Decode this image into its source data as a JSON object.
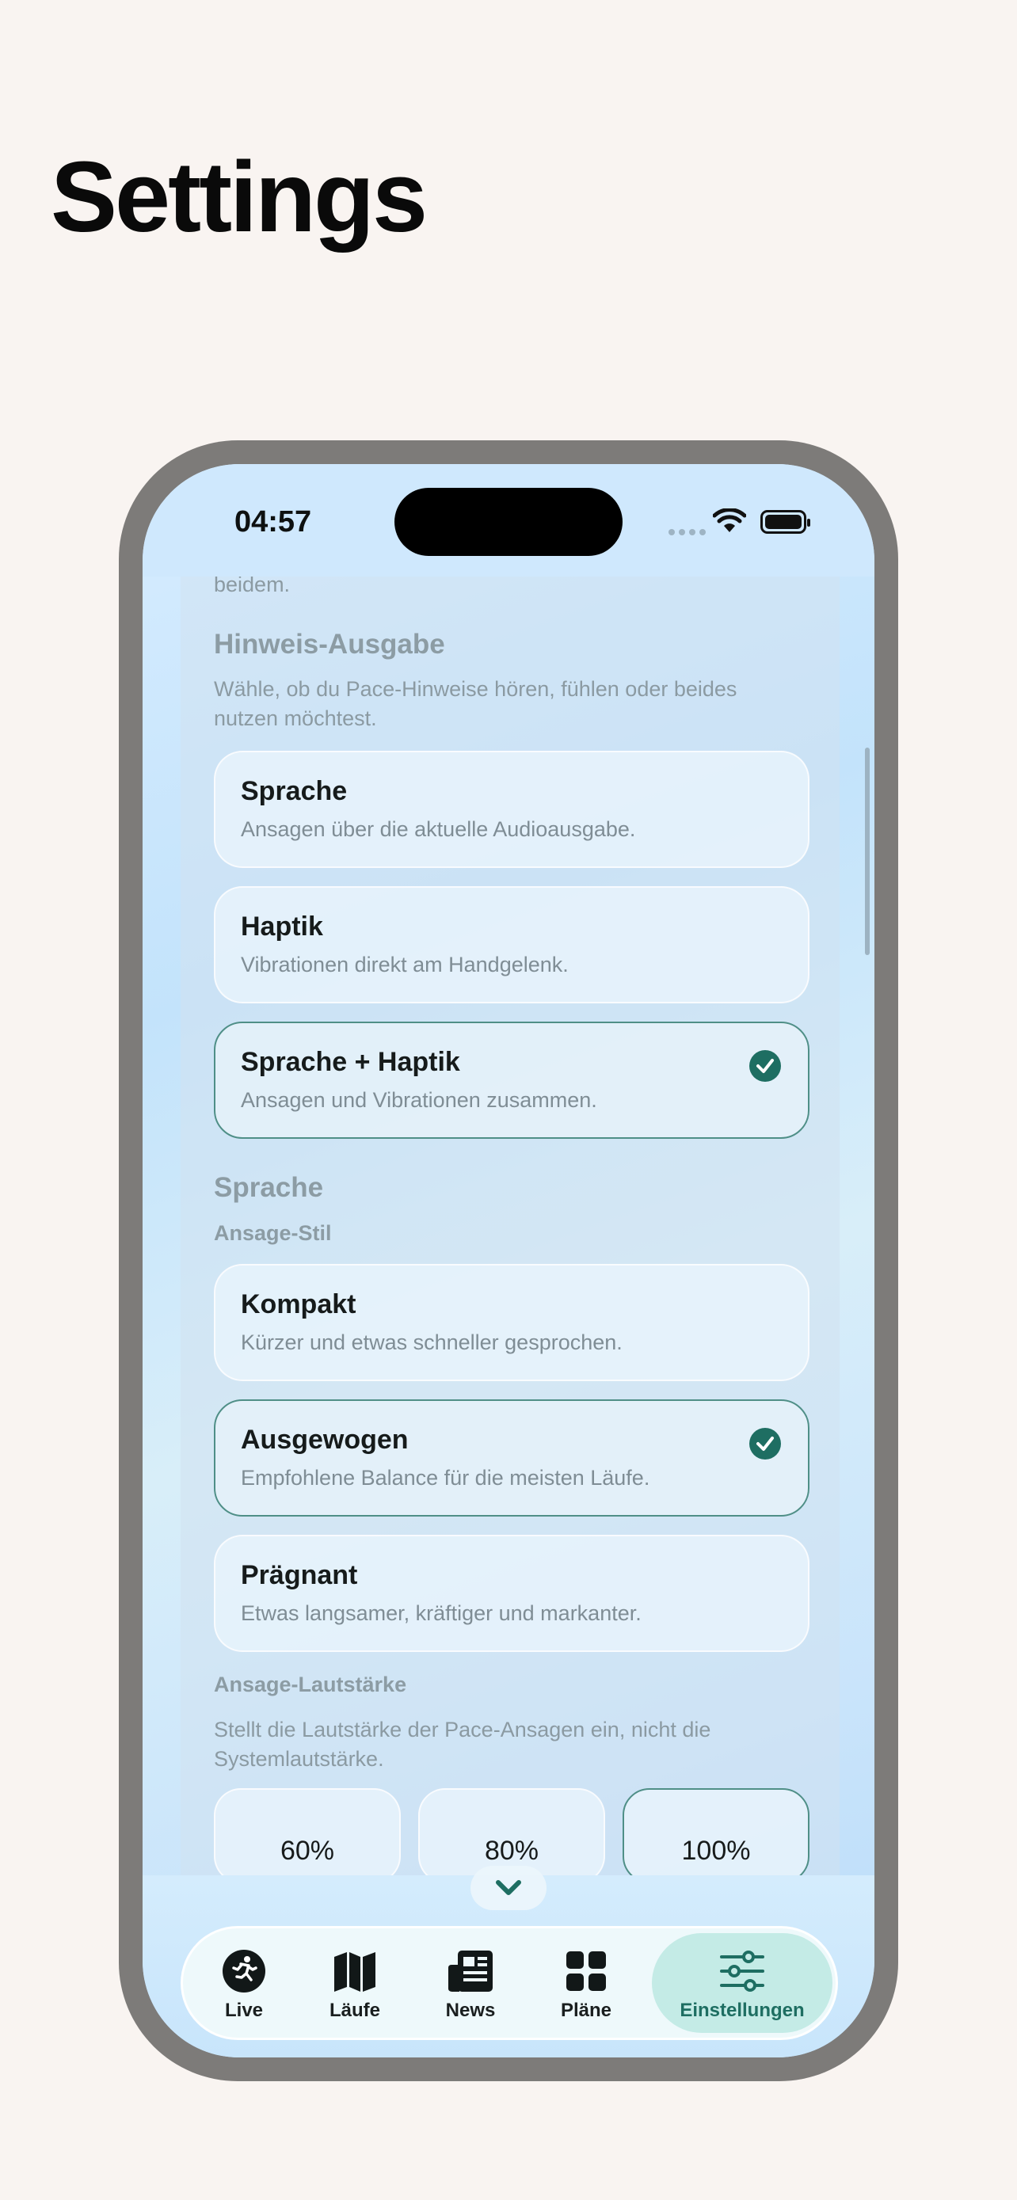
{
  "page": {
    "title": "Settings"
  },
  "status_bar": {
    "time": "04:57"
  },
  "content": {
    "top_clip_text": "beidem.",
    "hint_output": {
      "title": "Hinweis-Ausgabe",
      "description": "Wähle, ob du Pace-Hinweise hören, fühlen oder beides nutzen möchtest.",
      "options": [
        {
          "title": "Sprache",
          "description": "Ansagen über die aktuelle Audioausgabe.",
          "selected": false
        },
        {
          "title": "Haptik",
          "description": "Vibrationen direkt am Handgelenk.",
          "selected": false
        },
        {
          "title": "Sprache + Haptik",
          "description": "Ansagen und Vibrationen zusammen.",
          "selected": true
        }
      ]
    },
    "language": {
      "title": "Sprache",
      "style_label": "Ansage-Stil",
      "style_options": [
        {
          "title": "Kompakt",
          "description": "Kürzer und etwas schneller gesprochen.",
          "selected": false
        },
        {
          "title": "Ausgewogen",
          "description": "Empfohlene Balance für die meisten Läufe.",
          "selected": true
        },
        {
          "title": "Prägnant",
          "description": "Etwas langsamer, kräftiger und markanter.",
          "selected": false
        }
      ],
      "volume_label": "Ansage-Lautstärke",
      "volume_description": "Stellt die Lautstärke der Pace-Ansagen ein, nicht die Systemlautstärke.",
      "volume_options": [
        {
          "label": "60%",
          "selected": false
        },
        {
          "label": "80%",
          "selected": false
        },
        {
          "label": "100%",
          "selected": true
        }
      ]
    }
  },
  "tab_bar": {
    "tabs": [
      {
        "label": "Live",
        "icon": "runner-icon",
        "active": false
      },
      {
        "label": "Läufe",
        "icon": "map-icon",
        "active": false
      },
      {
        "label": "News",
        "icon": "newspaper-icon",
        "active": false
      },
      {
        "label": "Pläne",
        "icon": "grid-icon",
        "active": false
      },
      {
        "label": "Einstellungen",
        "icon": "sliders-icon",
        "active": true
      }
    ]
  },
  "colors": {
    "accent": "#1e6e62",
    "background": "#f9f4f1",
    "selected_tab_bg": "#c4ebe6"
  }
}
